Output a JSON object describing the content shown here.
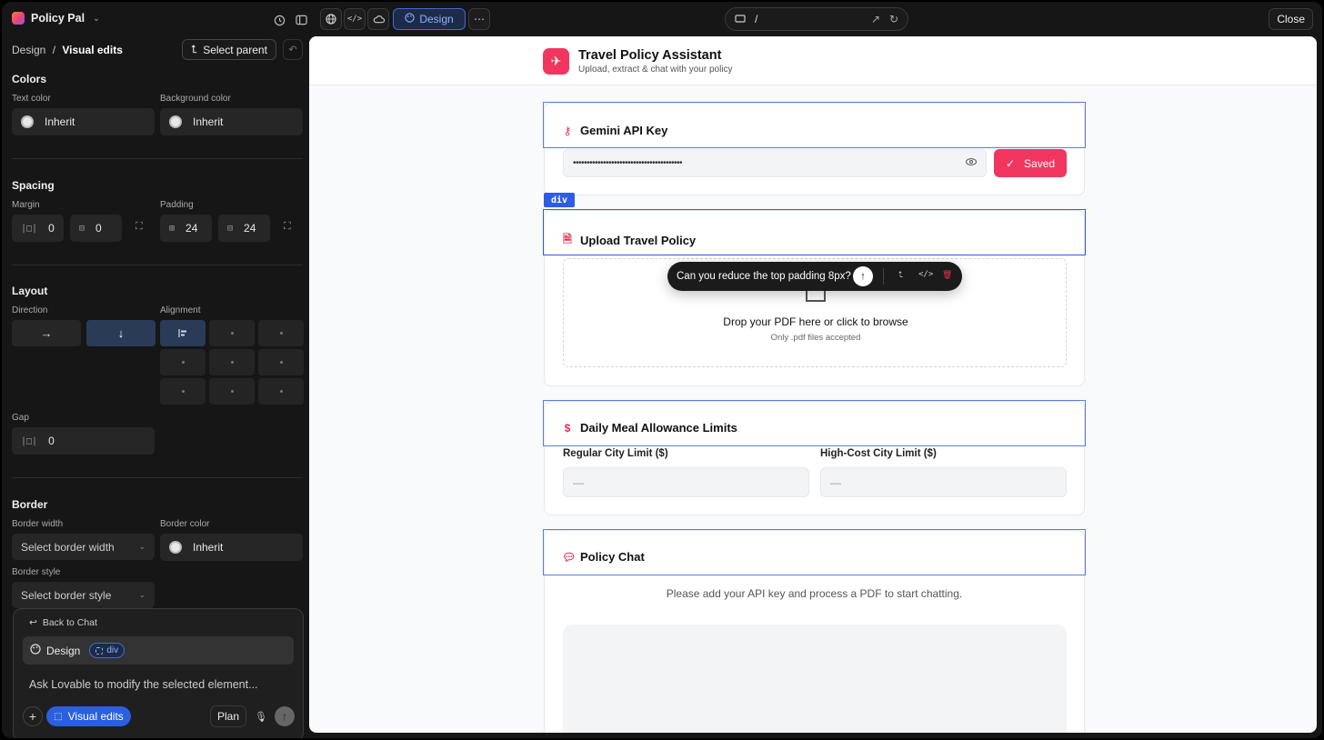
{
  "topbar": {
    "project_name": "Policy Pal",
    "design_label": "Design",
    "url_path": "/",
    "close_label": "Close"
  },
  "panel": {
    "breadcrumb_root": "Design",
    "breadcrumb_sep": "/",
    "breadcrumb_current": "Visual edits",
    "select_parent": "Select parent",
    "colors": {
      "title": "Colors",
      "text_color_label": "Text color",
      "text_color_value": "Inherit",
      "bg_color_label": "Background color",
      "bg_color_value": "Inherit"
    },
    "spacing": {
      "title": "Spacing",
      "margin_label": "Margin",
      "margin_x": "0",
      "margin_y": "0",
      "padding_label": "Padding",
      "padding_x": "24",
      "padding_y": "24"
    },
    "layout": {
      "title": "Layout",
      "direction_label": "Direction",
      "alignment_label": "Alignment",
      "gap_label": "Gap",
      "gap_value": "0"
    },
    "border": {
      "title": "Border",
      "width_label": "Border width",
      "width_placeholder": "Select border width",
      "color_label": "Border color",
      "color_value": "Inherit",
      "style_label": "Border style",
      "style_placeholder": "Select border style"
    }
  },
  "chat": {
    "back_label": "Back to Chat",
    "design_label": "Design",
    "element_tag": "div",
    "placeholder": "Ask Lovable to modify the selected element...",
    "visual_edits": "Visual edits",
    "plan": "Plan"
  },
  "preview": {
    "app_title": "Travel Policy Assistant",
    "app_subtitle": "Upload, extract & chat with your policy",
    "api_key": {
      "title": "Gemini API Key",
      "value": "••••••••••••••••••••••••••••••••••••••••",
      "saved_label": "Saved"
    },
    "selected_tag": "div",
    "upload": {
      "title": "Upload Travel Policy",
      "drop_text": "Drop your PDF here or click to browse",
      "accepted": "Only .pdf files accepted"
    },
    "edit_prompt": "Can you reduce the top padding 8px?",
    "meal": {
      "title": "Daily Meal Allowance Limits",
      "regular_label": "Regular City Limit ($)",
      "regular_value": "—",
      "high_label": "High-Cost City Limit ($)",
      "high_value": "—"
    },
    "chat": {
      "title": "Policy Chat",
      "hint": "Please add your API key and process a PDF to start chatting."
    }
  },
  "colors": {
    "accent": "#f0365f",
    "selection": "#2d5ce6",
    "design_mode": "#3d6bd6"
  }
}
